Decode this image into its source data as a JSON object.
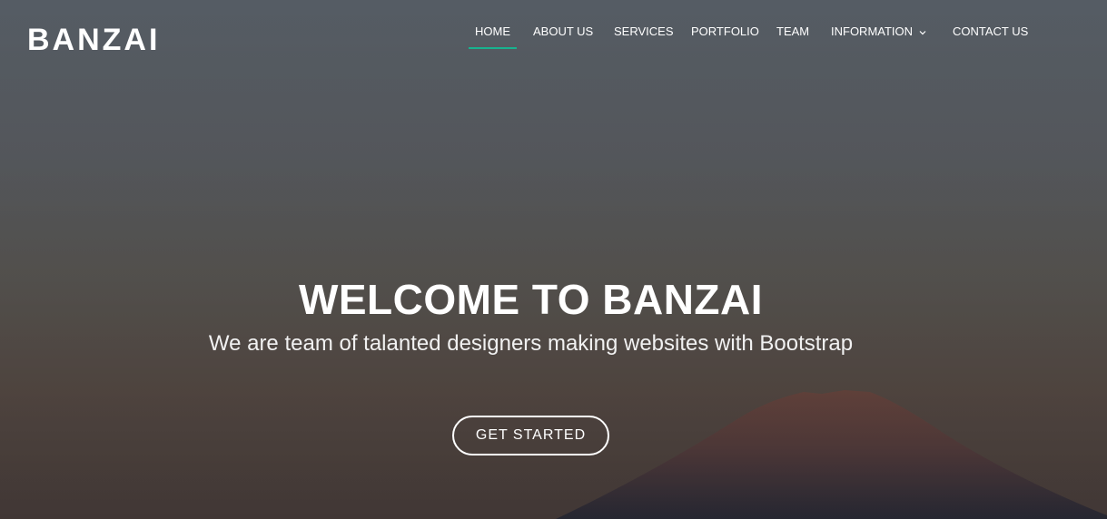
{
  "brand": {
    "logo_text": "BANZAI"
  },
  "nav": {
    "items": [
      {
        "label": "HOME",
        "active": true
      },
      {
        "label": "ABOUT US",
        "active": false
      },
      {
        "label": "SERVICES",
        "active": false
      },
      {
        "label": "PORTFOLIO",
        "active": false
      },
      {
        "label": "TEAM",
        "active": false
      },
      {
        "label": "INFORMATION",
        "active": false,
        "icon": "chevron-down-icon"
      },
      {
        "label": "CONTACT US",
        "active": false
      }
    ],
    "active_color": "#18b28f"
  },
  "hero": {
    "title": "WELCOME TO BANZAI",
    "subtitle": "We are team of talanted designers making websites with Bootstrap",
    "cta_label": "GET STARTED",
    "background_image": "mountain-at-dusk"
  }
}
